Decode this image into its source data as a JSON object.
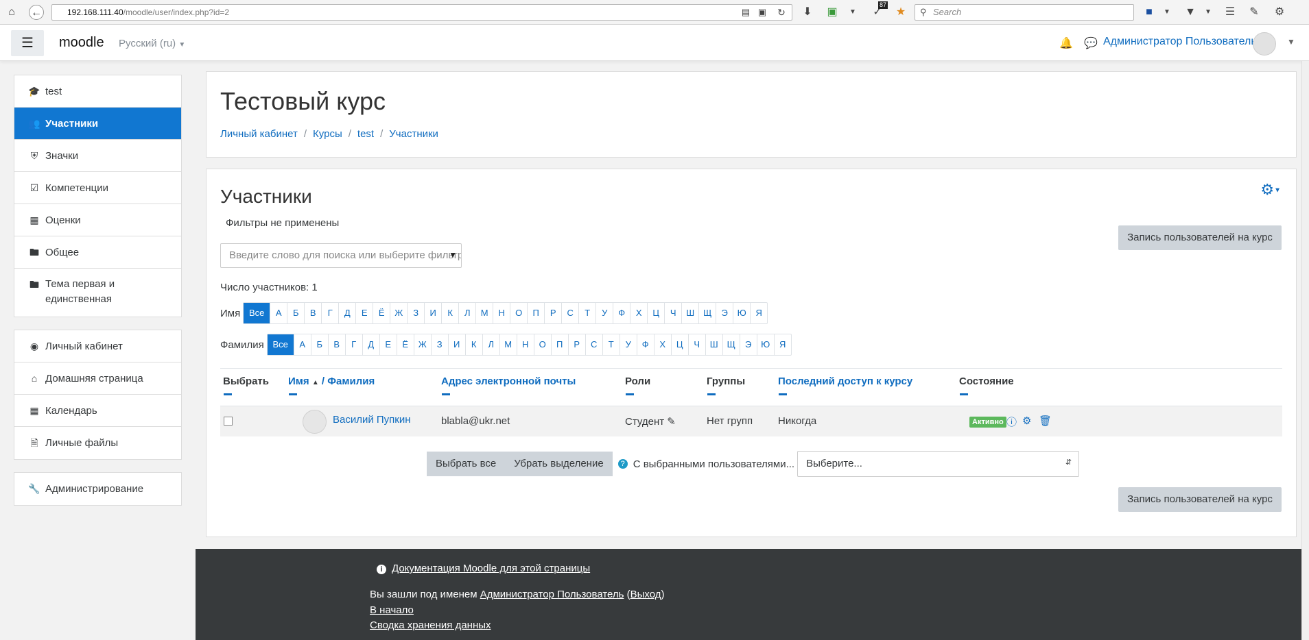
{
  "browser": {
    "url_host": "192.168.111.40",
    "url_path": "/moodle/user/index.php?id=2",
    "search_placeholder": "Search",
    "badge_count": "87"
  },
  "navbar": {
    "brand": "moodle",
    "language": "Русский (ru)",
    "user_name": "Администратор Пользователь"
  },
  "sidebar": {
    "course_items": [
      {
        "label": "test",
        "icon": "graduation-cap-icon"
      },
      {
        "label": "Участники",
        "icon": "users-icon"
      },
      {
        "label": "Значки",
        "icon": "shield-icon"
      },
      {
        "label": "Компетенции",
        "icon": "check-square-icon"
      },
      {
        "label": "Оценки",
        "icon": "table-icon"
      },
      {
        "label": "Общее",
        "icon": "folder-icon"
      },
      {
        "label": "Тема первая и единственная",
        "icon": "folder-icon"
      }
    ],
    "site_items": [
      {
        "label": "Личный кабинет",
        "icon": "dashboard-icon"
      },
      {
        "label": "Домашняя страница",
        "icon": "home-icon"
      },
      {
        "label": "Календарь",
        "icon": "calendar-icon"
      },
      {
        "label": "Личные файлы",
        "icon": "file-icon"
      }
    ],
    "admin_item": {
      "label": "Администрирование",
      "icon": "wrench-icon"
    }
  },
  "header": {
    "course_title": "Тестовый курс",
    "breadcrumb": [
      "Личный кабинет",
      "Курсы",
      "test",
      "Участники"
    ]
  },
  "participants": {
    "title": "Участники",
    "filter_status": "Фильтры не применены",
    "filter_placeholder": "Введите слово для поиска или выберите фильтр",
    "enrol_button": "Запись пользователей на курс",
    "count_label": "Число участников: 1",
    "first_name_label": "Имя",
    "last_name_label": "Фамилия",
    "alphabet_all": "Все",
    "alphabet": [
      "А",
      "Б",
      "В",
      "Г",
      "Д",
      "Е",
      "Ё",
      "Ж",
      "З",
      "И",
      "К",
      "Л",
      "М",
      "Н",
      "О",
      "П",
      "Р",
      "С",
      "Т",
      "У",
      "Ф",
      "Х",
      "Ц",
      "Ч",
      "Ш",
      "Щ",
      "Э",
      "Ю",
      "Я"
    ],
    "columns": {
      "select": "Выбрать",
      "first_name": "Имя",
      "last_name": "/ Фамилия",
      "email": "Адрес электронной почты",
      "roles": "Роли",
      "groups": "Группы",
      "last_access": "Последний доступ к курсу",
      "status": "Состояние"
    },
    "rows": [
      {
        "name": "Василий Пупкин",
        "email": "blabla@ukr.net",
        "role": "Студент",
        "groups": "Нет групп",
        "last_access": "Никогда",
        "status": "Активно"
      }
    ],
    "select_all": "Выбрать все",
    "deselect_all": "Убрать выделение",
    "with_selected": "С выбранными пользователями...",
    "bulk_select_value": "Выберите..."
  },
  "footer": {
    "doc_link": "Документация Moodle для этой страницы",
    "logged_in_prefix": "Вы зашли под именем",
    "logged_in_user": "Администратор Пользователь",
    "logout": "Выход",
    "home": "В начало",
    "data_retention": "Сводка хранения данных"
  },
  "colors": {
    "accent": "#1177d1",
    "link": "#0f6cbf",
    "badge_active": "#5cb85c",
    "footer_bg": "#373a3c"
  }
}
